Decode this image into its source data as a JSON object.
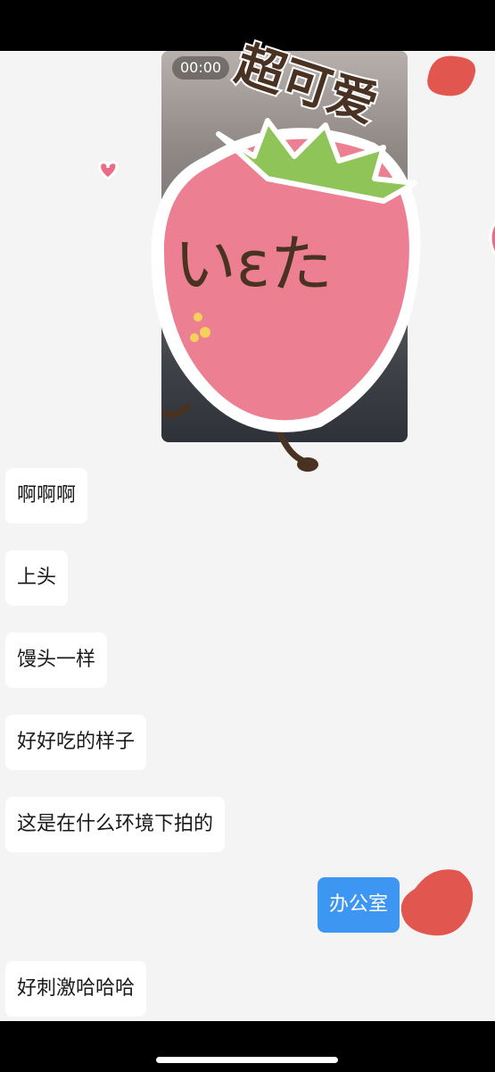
{
  "video": {
    "duration_label": "00:00"
  },
  "sticker": {
    "caption": "超可爱",
    "face": "いεた"
  },
  "messages": [
    {
      "side": "in",
      "text": "啊啊啊"
    },
    {
      "side": "in",
      "text": "上头"
    },
    {
      "side": "in",
      "text": "馒头一样"
    },
    {
      "side": "in",
      "text": "好好吃的样子"
    },
    {
      "side": "in",
      "text": "这是在什么环境下拍的"
    },
    {
      "side": "out",
      "text": "办公室"
    },
    {
      "side": "in",
      "text": "好刺激哈哈哈"
    }
  ],
  "colors": {
    "background": "#f4f4f4",
    "incoming_bubble": "#ffffff",
    "outgoing_bubble": "#3d97f2",
    "scribble": "#e1574f",
    "strawberry": "#ec7f92"
  }
}
